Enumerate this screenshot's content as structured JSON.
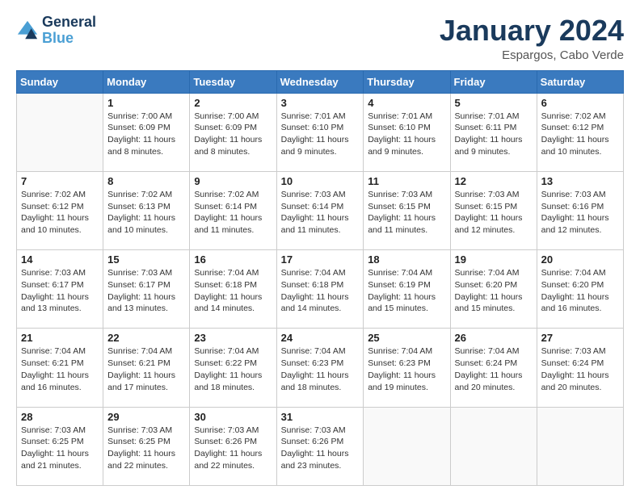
{
  "header": {
    "logo_line1": "General",
    "logo_line2": "Blue",
    "month": "January 2024",
    "location": "Espargos, Cabo Verde"
  },
  "days_of_week": [
    "Sunday",
    "Monday",
    "Tuesday",
    "Wednesday",
    "Thursday",
    "Friday",
    "Saturday"
  ],
  "weeks": [
    [
      {
        "day": "",
        "info": ""
      },
      {
        "day": "1",
        "info": "Sunrise: 7:00 AM\nSunset: 6:09 PM\nDaylight: 11 hours\nand 8 minutes."
      },
      {
        "day": "2",
        "info": "Sunrise: 7:00 AM\nSunset: 6:09 PM\nDaylight: 11 hours\nand 8 minutes."
      },
      {
        "day": "3",
        "info": "Sunrise: 7:01 AM\nSunset: 6:10 PM\nDaylight: 11 hours\nand 9 minutes."
      },
      {
        "day": "4",
        "info": "Sunrise: 7:01 AM\nSunset: 6:10 PM\nDaylight: 11 hours\nand 9 minutes."
      },
      {
        "day": "5",
        "info": "Sunrise: 7:01 AM\nSunset: 6:11 PM\nDaylight: 11 hours\nand 9 minutes."
      },
      {
        "day": "6",
        "info": "Sunrise: 7:02 AM\nSunset: 6:12 PM\nDaylight: 11 hours\nand 10 minutes."
      }
    ],
    [
      {
        "day": "7",
        "info": "Sunrise: 7:02 AM\nSunset: 6:12 PM\nDaylight: 11 hours\nand 10 minutes."
      },
      {
        "day": "8",
        "info": "Sunrise: 7:02 AM\nSunset: 6:13 PM\nDaylight: 11 hours\nand 10 minutes."
      },
      {
        "day": "9",
        "info": "Sunrise: 7:02 AM\nSunset: 6:14 PM\nDaylight: 11 hours\nand 11 minutes."
      },
      {
        "day": "10",
        "info": "Sunrise: 7:03 AM\nSunset: 6:14 PM\nDaylight: 11 hours\nand 11 minutes."
      },
      {
        "day": "11",
        "info": "Sunrise: 7:03 AM\nSunset: 6:15 PM\nDaylight: 11 hours\nand 11 minutes."
      },
      {
        "day": "12",
        "info": "Sunrise: 7:03 AM\nSunset: 6:15 PM\nDaylight: 11 hours\nand 12 minutes."
      },
      {
        "day": "13",
        "info": "Sunrise: 7:03 AM\nSunset: 6:16 PM\nDaylight: 11 hours\nand 12 minutes."
      }
    ],
    [
      {
        "day": "14",
        "info": "Sunrise: 7:03 AM\nSunset: 6:17 PM\nDaylight: 11 hours\nand 13 minutes."
      },
      {
        "day": "15",
        "info": "Sunrise: 7:03 AM\nSunset: 6:17 PM\nDaylight: 11 hours\nand 13 minutes."
      },
      {
        "day": "16",
        "info": "Sunrise: 7:04 AM\nSunset: 6:18 PM\nDaylight: 11 hours\nand 14 minutes."
      },
      {
        "day": "17",
        "info": "Sunrise: 7:04 AM\nSunset: 6:18 PM\nDaylight: 11 hours\nand 14 minutes."
      },
      {
        "day": "18",
        "info": "Sunrise: 7:04 AM\nSunset: 6:19 PM\nDaylight: 11 hours\nand 15 minutes."
      },
      {
        "day": "19",
        "info": "Sunrise: 7:04 AM\nSunset: 6:20 PM\nDaylight: 11 hours\nand 15 minutes."
      },
      {
        "day": "20",
        "info": "Sunrise: 7:04 AM\nSunset: 6:20 PM\nDaylight: 11 hours\nand 16 minutes."
      }
    ],
    [
      {
        "day": "21",
        "info": "Sunrise: 7:04 AM\nSunset: 6:21 PM\nDaylight: 11 hours\nand 16 minutes."
      },
      {
        "day": "22",
        "info": "Sunrise: 7:04 AM\nSunset: 6:21 PM\nDaylight: 11 hours\nand 17 minutes."
      },
      {
        "day": "23",
        "info": "Sunrise: 7:04 AM\nSunset: 6:22 PM\nDaylight: 11 hours\nand 18 minutes."
      },
      {
        "day": "24",
        "info": "Sunrise: 7:04 AM\nSunset: 6:23 PM\nDaylight: 11 hours\nand 18 minutes."
      },
      {
        "day": "25",
        "info": "Sunrise: 7:04 AM\nSunset: 6:23 PM\nDaylight: 11 hours\nand 19 minutes."
      },
      {
        "day": "26",
        "info": "Sunrise: 7:04 AM\nSunset: 6:24 PM\nDaylight: 11 hours\nand 20 minutes."
      },
      {
        "day": "27",
        "info": "Sunrise: 7:03 AM\nSunset: 6:24 PM\nDaylight: 11 hours\nand 20 minutes."
      }
    ],
    [
      {
        "day": "28",
        "info": "Sunrise: 7:03 AM\nSunset: 6:25 PM\nDaylight: 11 hours\nand 21 minutes."
      },
      {
        "day": "29",
        "info": "Sunrise: 7:03 AM\nSunset: 6:25 PM\nDaylight: 11 hours\nand 22 minutes."
      },
      {
        "day": "30",
        "info": "Sunrise: 7:03 AM\nSunset: 6:26 PM\nDaylight: 11 hours\nand 22 minutes."
      },
      {
        "day": "31",
        "info": "Sunrise: 7:03 AM\nSunset: 6:26 PM\nDaylight: 11 hours\nand 23 minutes."
      },
      {
        "day": "",
        "info": ""
      },
      {
        "day": "",
        "info": ""
      },
      {
        "day": "",
        "info": ""
      }
    ]
  ]
}
